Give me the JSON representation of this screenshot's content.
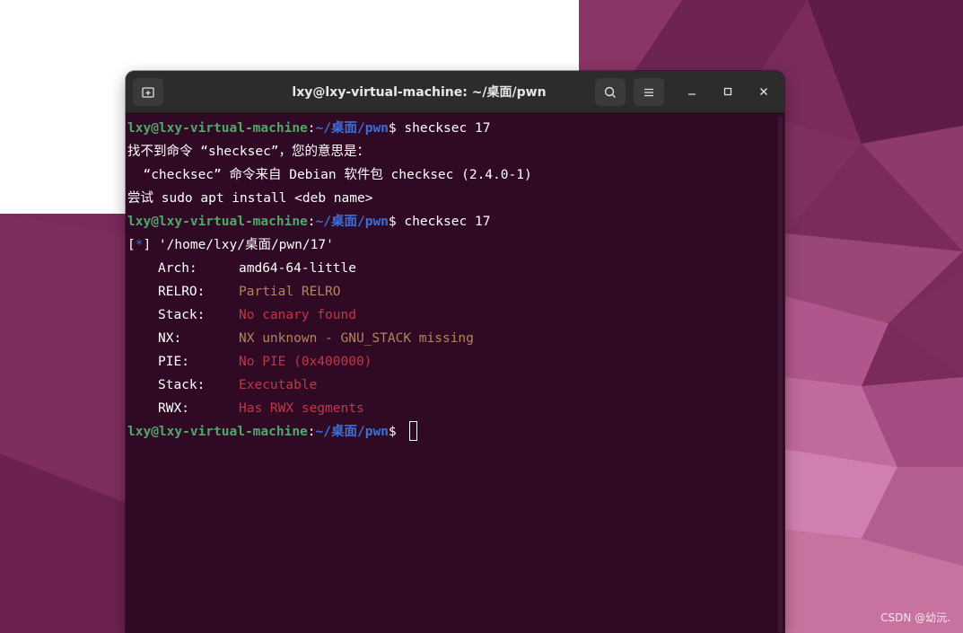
{
  "window": {
    "title": "lxy@lxy-virtual-machine: ~/桌面/pwn"
  },
  "icons": {
    "new_tab": "new-tab-icon",
    "search": "search-icon",
    "menu": "hamburger-menu-icon",
    "minimize": "minimize-icon",
    "maximize": "maximize-icon",
    "close": "close-icon"
  },
  "colors": {
    "terminal_bg": "#300a24",
    "prompt_user": "#4ea86a",
    "prompt_path": "#3d6fd6",
    "warning": "#b3855a",
    "error": "#c23646"
  },
  "terminal": {
    "prompt_user": "lxy@lxy-virtual-machine",
    "prompt_sep": ":",
    "prompt_path": "~/桌面/pwn",
    "prompt_dollar": "$ ",
    "cmd1": "shecksec 17",
    "out1": "找不到命令 “shecksec”，您的意思是：",
    "out2": "  “checksec” 命令来自 Debian 软件包 checksec (2.4.0-1)",
    "out3": "尝试 sudo apt install <deb name>",
    "cmd2": "checksec 17",
    "file_bracket_open": "[",
    "file_star": "*",
    "file_bracket_close": "] '/home/lxy/桌面/pwn/17'",
    "props": [
      {
        "label": "Arch:",
        "value": "amd64-64-little"
      },
      {
        "label": "RELRO:",
        "value": "Partial RELRO"
      },
      {
        "label": "Stack:",
        "value": "No canary found"
      },
      {
        "label": "NX:",
        "value": "NX unknown - GNU_STACK missing"
      },
      {
        "label": "PIE:",
        "value": "No PIE (0x400000)"
      },
      {
        "label": "Stack:",
        "value": "Executable"
      },
      {
        "label": "RWX:",
        "value": "Has RWX segments"
      }
    ]
  },
  "watermark": "CSDN @幼沅."
}
